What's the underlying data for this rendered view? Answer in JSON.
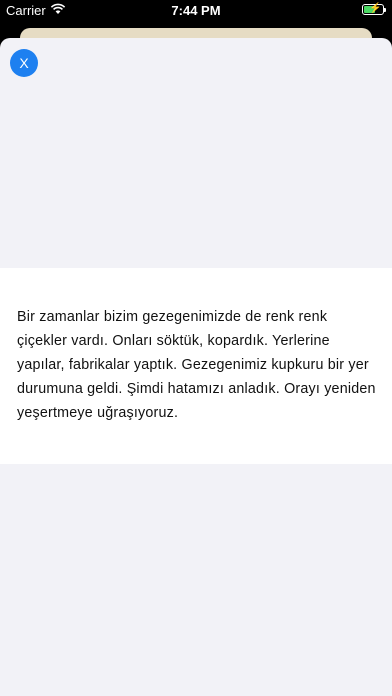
{
  "status_bar": {
    "carrier": "Carrier",
    "time": "7:44 PM",
    "wifi_icon": "wifi-icon",
    "battery_icon": "battery-charging-icon",
    "battery_color": "#4cd964"
  },
  "sheet": {
    "close_label": "X",
    "close_color": "#1e80f0",
    "story_text": "Bir zamanlar bizim gezegenimizde de renk renk çiçekler vardı. Onları söktük, kopardık. Yerlerine yapılar, fabrikalar yaptık. Gezegenimiz kupkuru bir yer durumuna geldi. Şimdi hatamızı anladık. Orayı yeniden yeşertmeye uğraşıyoruz."
  }
}
